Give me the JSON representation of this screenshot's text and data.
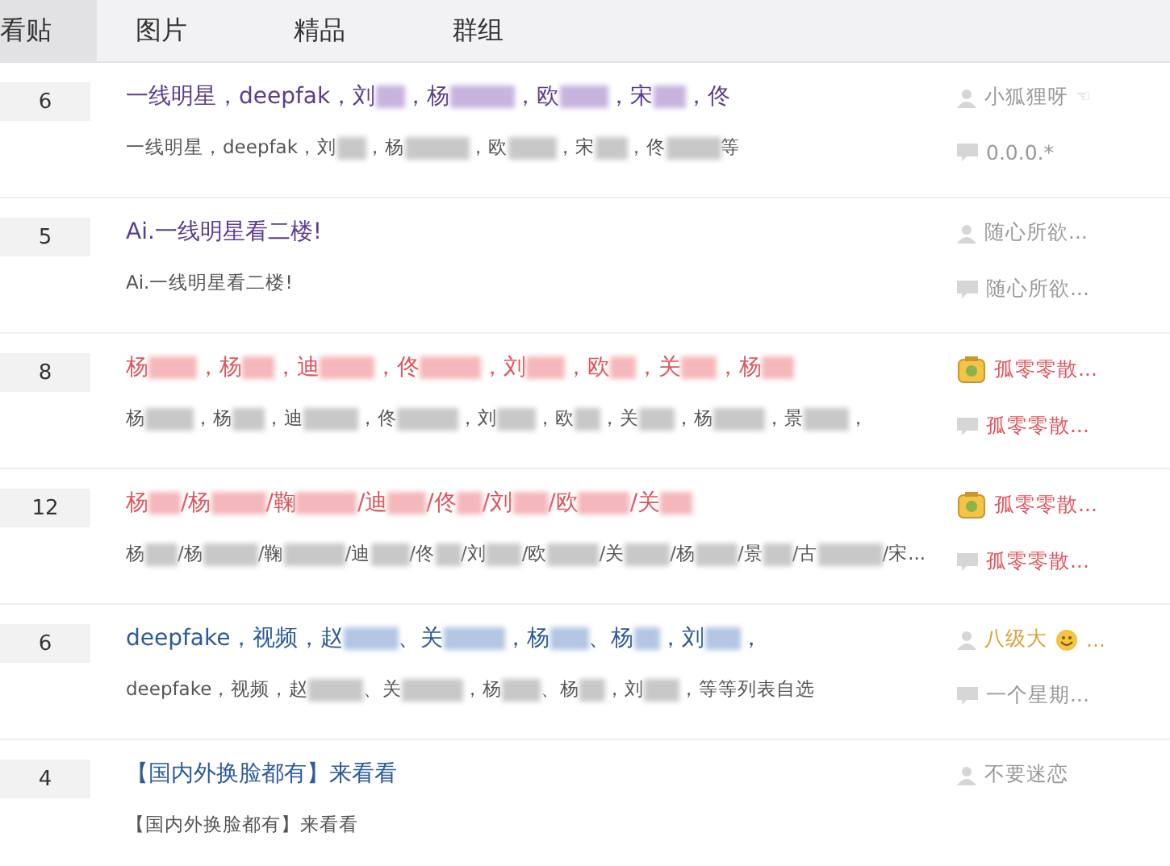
{
  "tabs": [
    {
      "label": "看贴",
      "selected": true
    },
    {
      "label": "图片",
      "selected": false
    },
    {
      "label": "精品",
      "selected": false
    },
    {
      "label": "群组",
      "selected": false
    }
  ],
  "threads": [
    {
      "replies": "6",
      "title": {
        "kind": "visited",
        "parts": [
          "一线明星，deepfak，刘",
          "，杨",
          "，欧",
          "，宋",
          "，佟"
        ],
        "trailing_blur": false
      },
      "abstract_parts": [
        "一线明星，deepfak，刘",
        "，杨",
        "，欧",
        "，宋",
        "，佟",
        "等"
      ],
      "author": {
        "kind": "plain",
        "name": "小狐狸呀",
        "suffix": {
          "kind": "glyph",
          "text": "☜"
        }
      },
      "last_reply": "0.0.0.*"
    },
    {
      "replies": "5",
      "title": {
        "kind": "visited",
        "parts": [
          "Ai.一线明星看二楼!"
        ],
        "trailing_blur": false
      },
      "abstract_parts": [
        "Ai.一线明星看二楼!"
      ],
      "author": {
        "kind": "plain",
        "name": "随心所欲..."
      },
      "last_reply": "随心所欲..."
    },
    {
      "replies": "8",
      "title": {
        "kind": "hot",
        "parts": [
          "杨",
          "，杨",
          "，迪",
          "，佟",
          "，刘",
          "，欧",
          "，关",
          "，杨"
        ],
        "trailing_blur": true
      },
      "abstract_parts": [
        "杨",
        "，杨",
        "，迪",
        "，佟",
        "，刘",
        "，欧",
        "，关",
        "，杨",
        "，景",
        "，"
      ],
      "author": {
        "kind": "member",
        "name": "孤零零散..."
      },
      "last_reply": "孤零零散..."
    },
    {
      "replies": "12",
      "title": {
        "kind": "hot",
        "parts": [
          "杨",
          "/杨",
          "/鞠",
          "/迪",
          "/佟",
          "/刘",
          "/欧",
          "/关"
        ],
        "trailing_blur": true
      },
      "abstract_parts": [
        "杨",
        "/杨",
        "/鞠",
        "/迪",
        "/佟",
        "/刘",
        "/欧",
        "/关",
        "/杨",
        "/景",
        "/古",
        "/宋..."
      ],
      "author": {
        "kind": "member",
        "name": "孤零零散..."
      },
      "last_reply": "孤零零散..."
    },
    {
      "replies": "6",
      "title": {
        "kind": "normal",
        "parts": [
          "deepfake，视频，赵",
          "、关",
          "，杨",
          "、杨",
          "，刘",
          "，"
        ],
        "trailing_blur": false
      },
      "abstract_parts": [
        "deepfake，视频，赵",
        "、关",
        "，杨",
        "、杨",
        "，刘",
        "，等等列表自选"
      ],
      "author": {
        "kind": "senior",
        "name": "八级大",
        "suffix": {
          "kind": "smile"
        },
        "tail": "..."
      },
      "last_reply": "一个星期..."
    },
    {
      "replies": "4",
      "title": {
        "kind": "normal",
        "parts": [
          "【国内外换脸都有】来看看"
        ],
        "trailing_blur": false
      },
      "abstract_parts": [
        "【国内外换脸都有】来看看"
      ],
      "author": {
        "kind": "plain",
        "name": "不要迷恋"
      }
    }
  ]
}
